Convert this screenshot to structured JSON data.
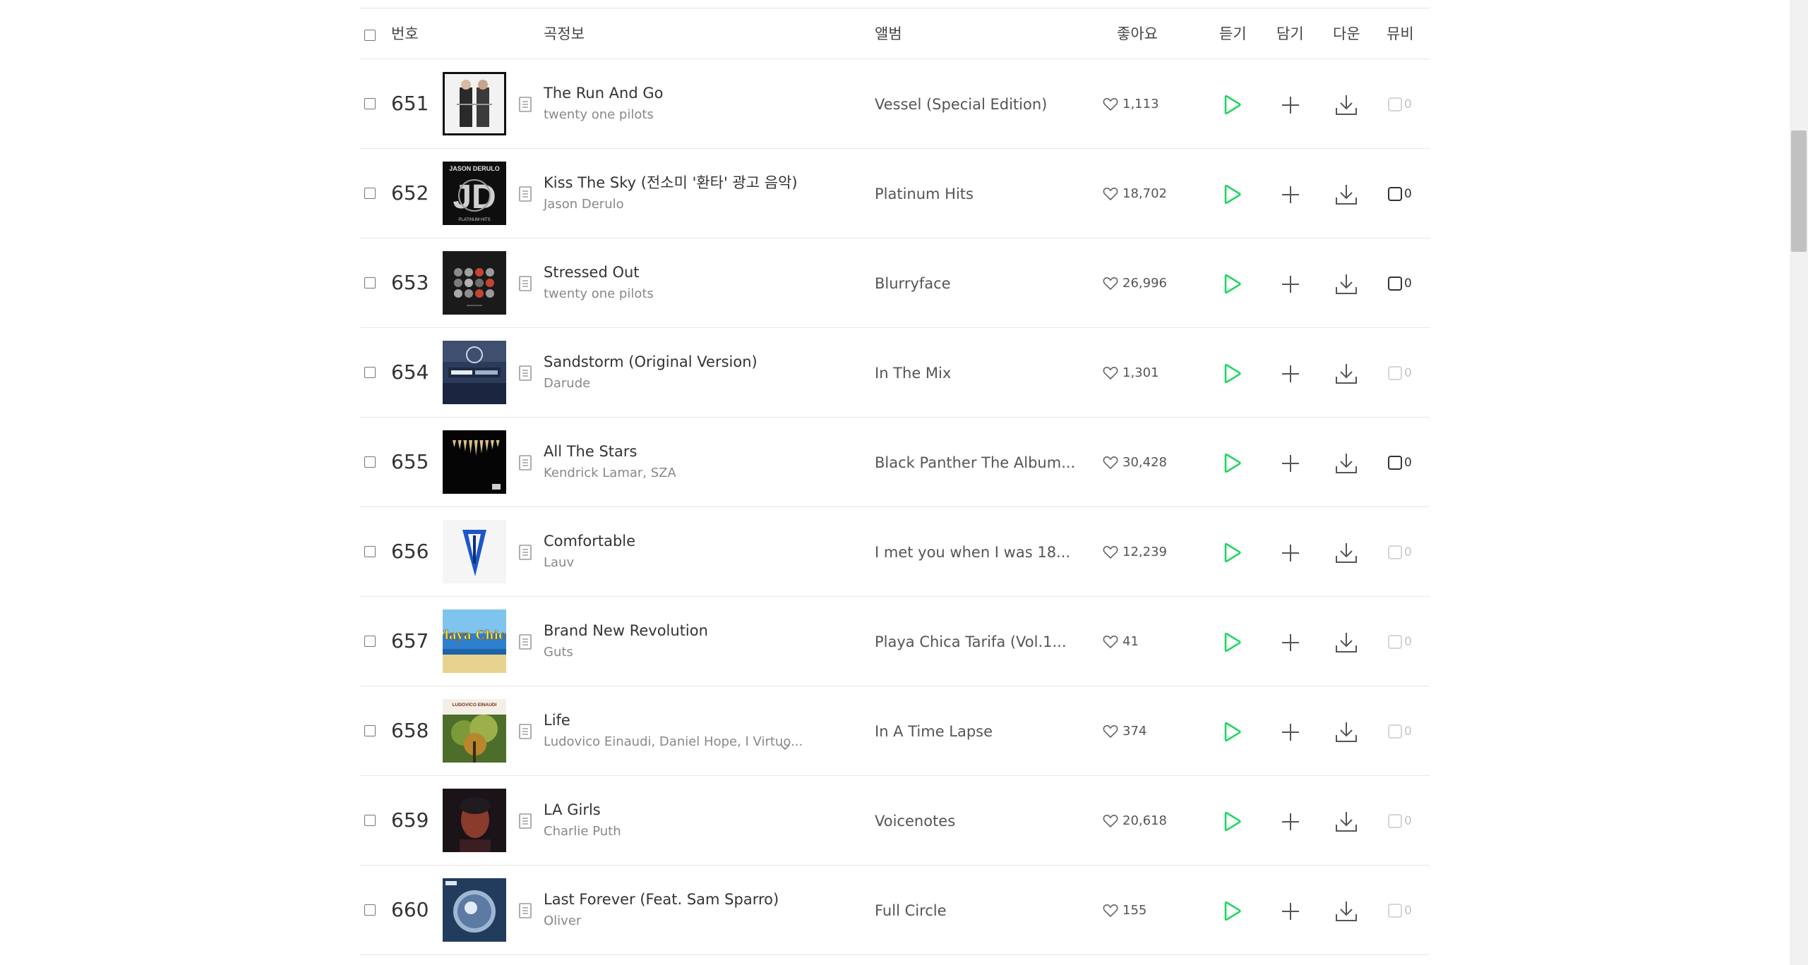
{
  "header": {
    "rank": "번호",
    "song_info": "곡정보",
    "album": "앨범",
    "likes": "좋아요",
    "listen": "듣기",
    "add": "담기",
    "download": "다운",
    "mv": "뮤비"
  },
  "icons": {
    "select_all": "checkbox-icon",
    "detail": "song-detail-icon",
    "like": "heart-outline-icon",
    "play": "play-icon",
    "add": "plus-icon",
    "download": "download-icon",
    "mv": "mv-box-icon",
    "more": "chevron-down-icon"
  },
  "colors": {
    "play_accent": "#1ed760",
    "mv_active": "#333333",
    "mv_inactive": "#d6d6d6"
  },
  "songs": [
    {
      "rank": "651",
      "title": "The Run And Go",
      "artist": "twenty one pilots",
      "album": "Vessel (Special Edition)",
      "likes": "1,113",
      "mv_count": "0",
      "mv_available": false,
      "cover_style": "vessel"
    },
    {
      "rank": "652",
      "title": "Kiss The Sky (전소미 '환타' 광고 음악)",
      "artist": "Jason Derulo",
      "album": "Platinum Hits",
      "likes": "18,702",
      "mv_count": "0",
      "mv_available": true,
      "cover_style": "derulo",
      "cover_text": "JASON DERULO",
      "cover_subtext": "PLATINUM HITS"
    },
    {
      "rank": "653",
      "title": "Stressed Out",
      "artist": "twenty one pilots",
      "album": "Blurryface",
      "likes": "26,996",
      "mv_count": "0",
      "mv_available": true,
      "cover_style": "blurryface"
    },
    {
      "rank": "654",
      "title": "Sandstorm (Original Version)",
      "artist": "Darude",
      "album": "In The Mix",
      "likes": "1,301",
      "mv_count": "0",
      "mv_available": false,
      "cover_style": "inthemix"
    },
    {
      "rank": "655",
      "title": "All The Stars",
      "artist": "Kendrick Lamar, SZA",
      "album": "Black Panther The Album...",
      "likes": "30,428",
      "mv_count": "0",
      "mv_available": true,
      "cover_style": "panther"
    },
    {
      "rank": "656",
      "title": "Comfortable",
      "artist": "Lauv",
      "album": "I met you when I was 18...",
      "likes": "12,239",
      "mv_count": "0",
      "mv_available": false,
      "cover_style": "lauv"
    },
    {
      "rank": "657",
      "title": "Brand New Revolution",
      "artist": "Guts",
      "album": "Playa Chica Tarifa (Vol.1...",
      "likes": "41",
      "mv_count": "0",
      "mv_available": false,
      "cover_style": "playa",
      "cover_text": "Playa Chica"
    },
    {
      "rank": "658",
      "title": "Life",
      "artist": "Ludovico Einaudi, Daniel Hope, I Virtuo...",
      "album": "In A Time Lapse",
      "likes": "374",
      "mv_count": "0",
      "mv_available": false,
      "cover_style": "einaudi",
      "cover_text": "LUDOVICO EINAUDI",
      "has_more_artists": true
    },
    {
      "rank": "659",
      "title": "LA Girls",
      "artist": "Charlie Puth",
      "album": "Voicenotes",
      "likes": "20,618",
      "mv_count": "0",
      "mv_available": false,
      "cover_style": "puth"
    },
    {
      "rank": "660",
      "title": "Last Forever (Feat. Sam Sparro)",
      "artist": "Oliver",
      "album": "Full Circle",
      "likes": "155",
      "mv_count": "0",
      "mv_available": false,
      "cover_style": "oliver"
    }
  ]
}
